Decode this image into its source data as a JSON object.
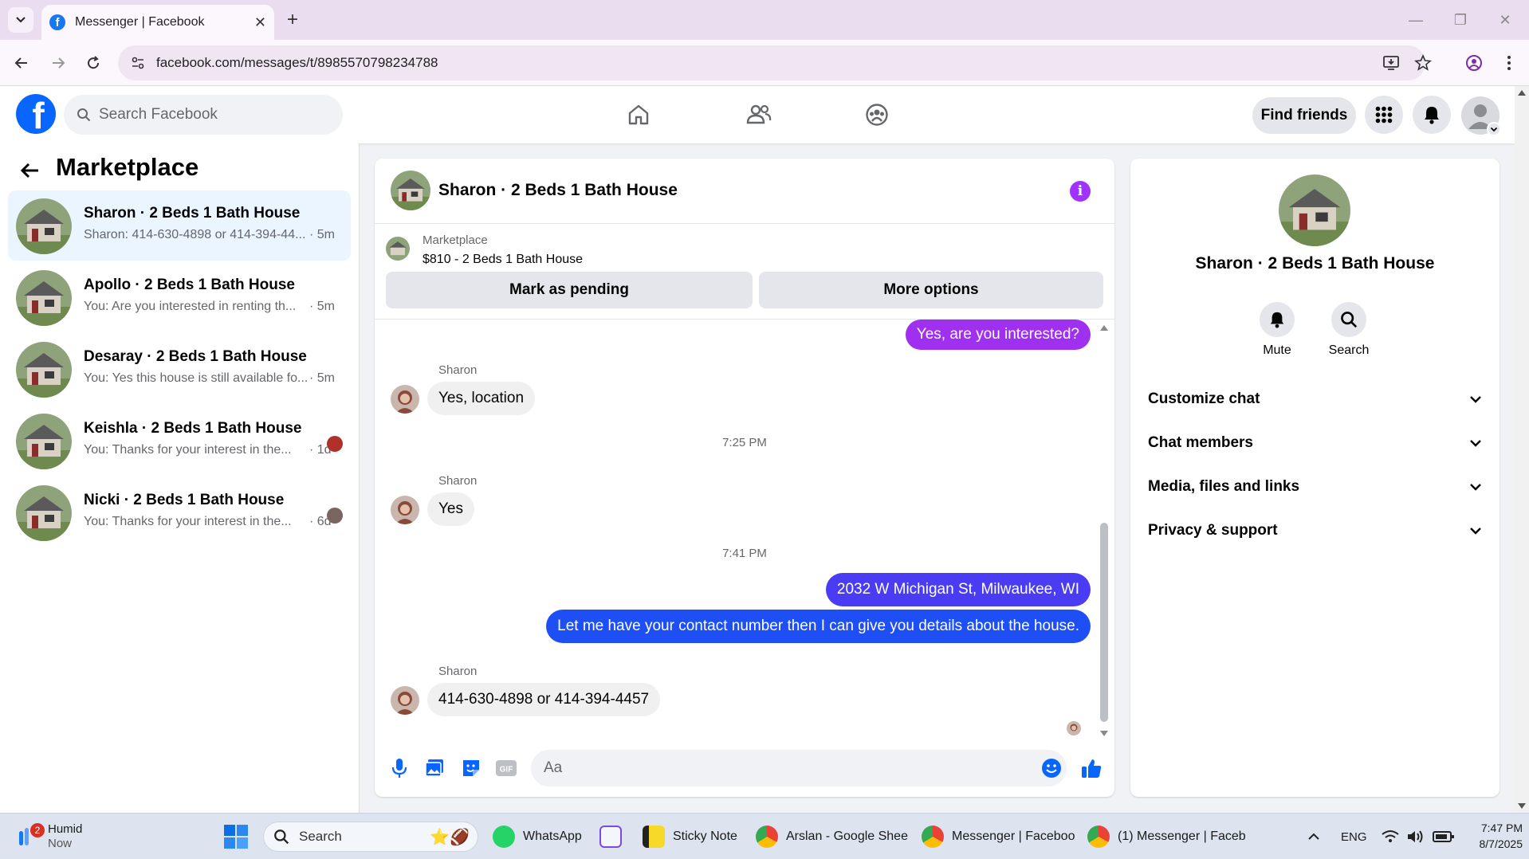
{
  "browser": {
    "tab_title": "Messenger | Facebook",
    "url": "facebook.com/messages/t/8985570798234788"
  },
  "fb_header": {
    "search_placeholder": "Search Facebook",
    "find_friends": "Find friends"
  },
  "sidebar": {
    "title": "Marketplace",
    "conversations": [
      {
        "name": "Sharon · 2 Beds 1 Bath House",
        "preview": "Sharon: 414-630-4898 or 414-394-44...",
        "time": "· 5m"
      },
      {
        "name": "Apollo · 2 Beds 1 Bath House",
        "preview": "You: Are you interested in renting th...",
        "time": "· 5m"
      },
      {
        "name": "Desaray · 2 Beds 1 Bath House",
        "preview": "You: Yes this house is still available fo...",
        "time": "· 5m"
      },
      {
        "name": "Keishla · 2 Beds 1 Bath House",
        "preview": "You: Thanks for your interest in the...",
        "time": "· 1d"
      },
      {
        "name": "Nicki · 2 Beds 1 Bath House",
        "preview": "You: Thanks for your interest in the...",
        "time": "· 6d"
      }
    ]
  },
  "chat": {
    "title": "Sharon · 2 Beds 1 Bath House",
    "marketplace_label": "Marketplace",
    "listing": "$810 - 2 Beds 1 Bath House",
    "mark_pending": "Mark as pending",
    "more_options": "More options",
    "messages": {
      "m1": "Yes, are you interested?",
      "sender1": "Sharon",
      "m2": "Yes, location",
      "time1": "7:25 PM",
      "sender2": "Sharon",
      "m3": "Yes",
      "time2": "7:41 PM",
      "m4": "2032 W Michigan St, Milwaukee, WI",
      "m5": "Let me have your contact number then I can give you details about the house.",
      "sender3": "Sharon",
      "m6": "414-630-4898 or 414-394-4457"
    },
    "input_placeholder": "Aa",
    "outgoing_color_top": "#a030f0",
    "outgoing_color_bottom": "#1d4ff5"
  },
  "info_panel": {
    "name": "Sharon · 2 Beds 1 Bath House",
    "mute": "Mute",
    "search": "Search",
    "rows": [
      "Customize chat",
      "Chat members",
      "Media, files and links",
      "Privacy & support"
    ]
  },
  "taskbar": {
    "weather_title": "Humid",
    "weather_sub": "Now",
    "weather_badge": "2",
    "search": "Search",
    "apps": [
      "WhatsApp",
      "Sticky Note",
      "Arslan - Google Shee",
      "Messenger | Faceboo",
      "(1) Messenger | Faceb"
    ],
    "lang": "ENG",
    "time": "7:47 PM",
    "date": "8/7/2025"
  }
}
